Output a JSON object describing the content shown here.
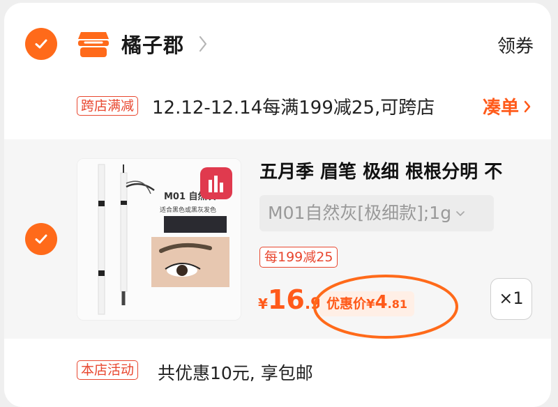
{
  "shop": {
    "name": "橘子郡",
    "coupon_label": "领券"
  },
  "promo": {
    "tag": "跨店满减",
    "text": "12.12-12.14每满199减25,可跨店",
    "action": "凑单"
  },
  "item": {
    "title": "五月季 眉笔 极细 根根分明 不",
    "sku": "M01自然灰[极细款];1g",
    "badge": "每199减25",
    "price_currency": "¥",
    "price_int": "16",
    "price_dec": ".9",
    "discount_label": "优惠价",
    "discount_currency": "¥",
    "discount_int": "4",
    "discount_dec": ".81",
    "quantity": "×1",
    "image_text": {
      "model": "M01 自然灰",
      "desc": "适合黑色或黑灰发色"
    }
  },
  "activity": {
    "tag": "本店活动",
    "text": "共优惠10元, 享包邮"
  },
  "colors": {
    "accent": "#ff6a1a",
    "tag_red": "#e8462e",
    "annotation": "#ff6a1a"
  }
}
